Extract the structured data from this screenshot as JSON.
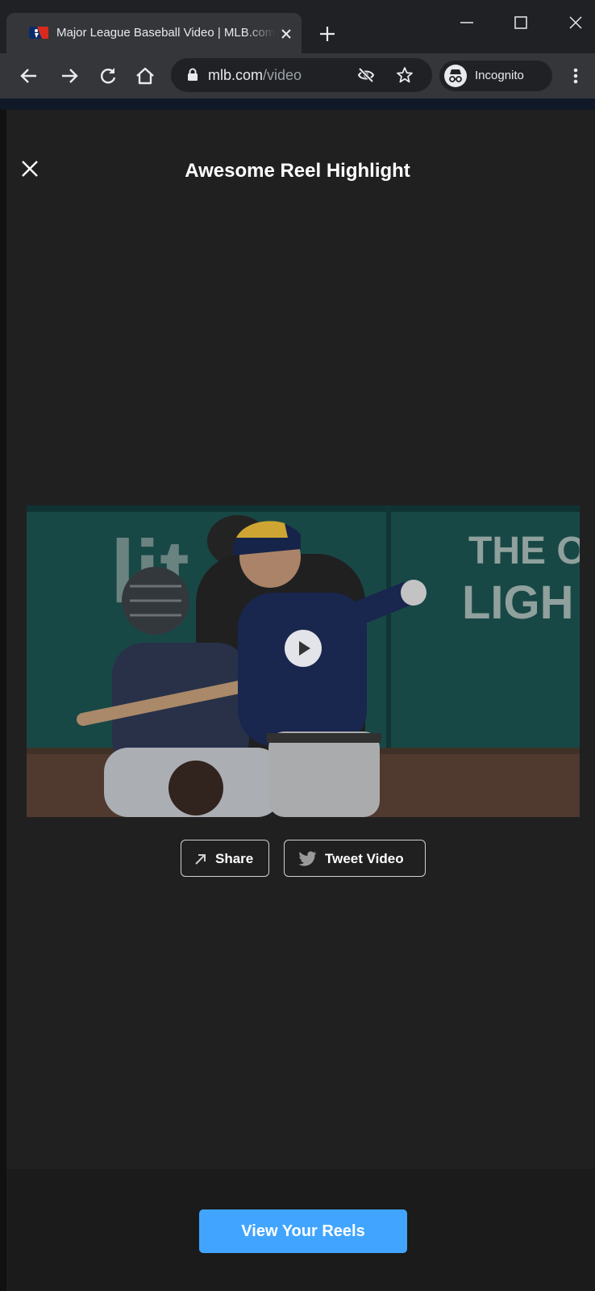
{
  "browser": {
    "tab_title": "Major League Baseball Video | MLB.com",
    "url_host": "mlb.com",
    "url_path": "/video",
    "incognito_label": "Incognito"
  },
  "modal": {
    "title": "Awesome Reel Highlight"
  },
  "video": {
    "signage_line1": "THE OR",
    "signage_line2": "LIGH",
    "signage_left": "lit"
  },
  "actions": {
    "share_label": "Share",
    "tweet_label": "Tweet Video"
  },
  "footer": {
    "cta_label": "View Your Reels"
  },
  "colors": {
    "accent": "#41a5ff",
    "background": "#202020",
    "chrome_dark": "#202124",
    "chrome_toolbar": "#35363a"
  },
  "icons": [
    "mlb-favicon-icon",
    "tab-close-icon",
    "new-tab-icon",
    "minimize-icon",
    "maximize-icon",
    "window-close-icon",
    "back-icon",
    "forward-icon",
    "reload-icon",
    "home-icon",
    "lock-icon",
    "eye-slash-icon",
    "star-icon",
    "incognito-icon",
    "kebab-menu-icon",
    "close-icon",
    "play-icon",
    "share-arrow-icon",
    "twitter-bird-icon"
  ]
}
